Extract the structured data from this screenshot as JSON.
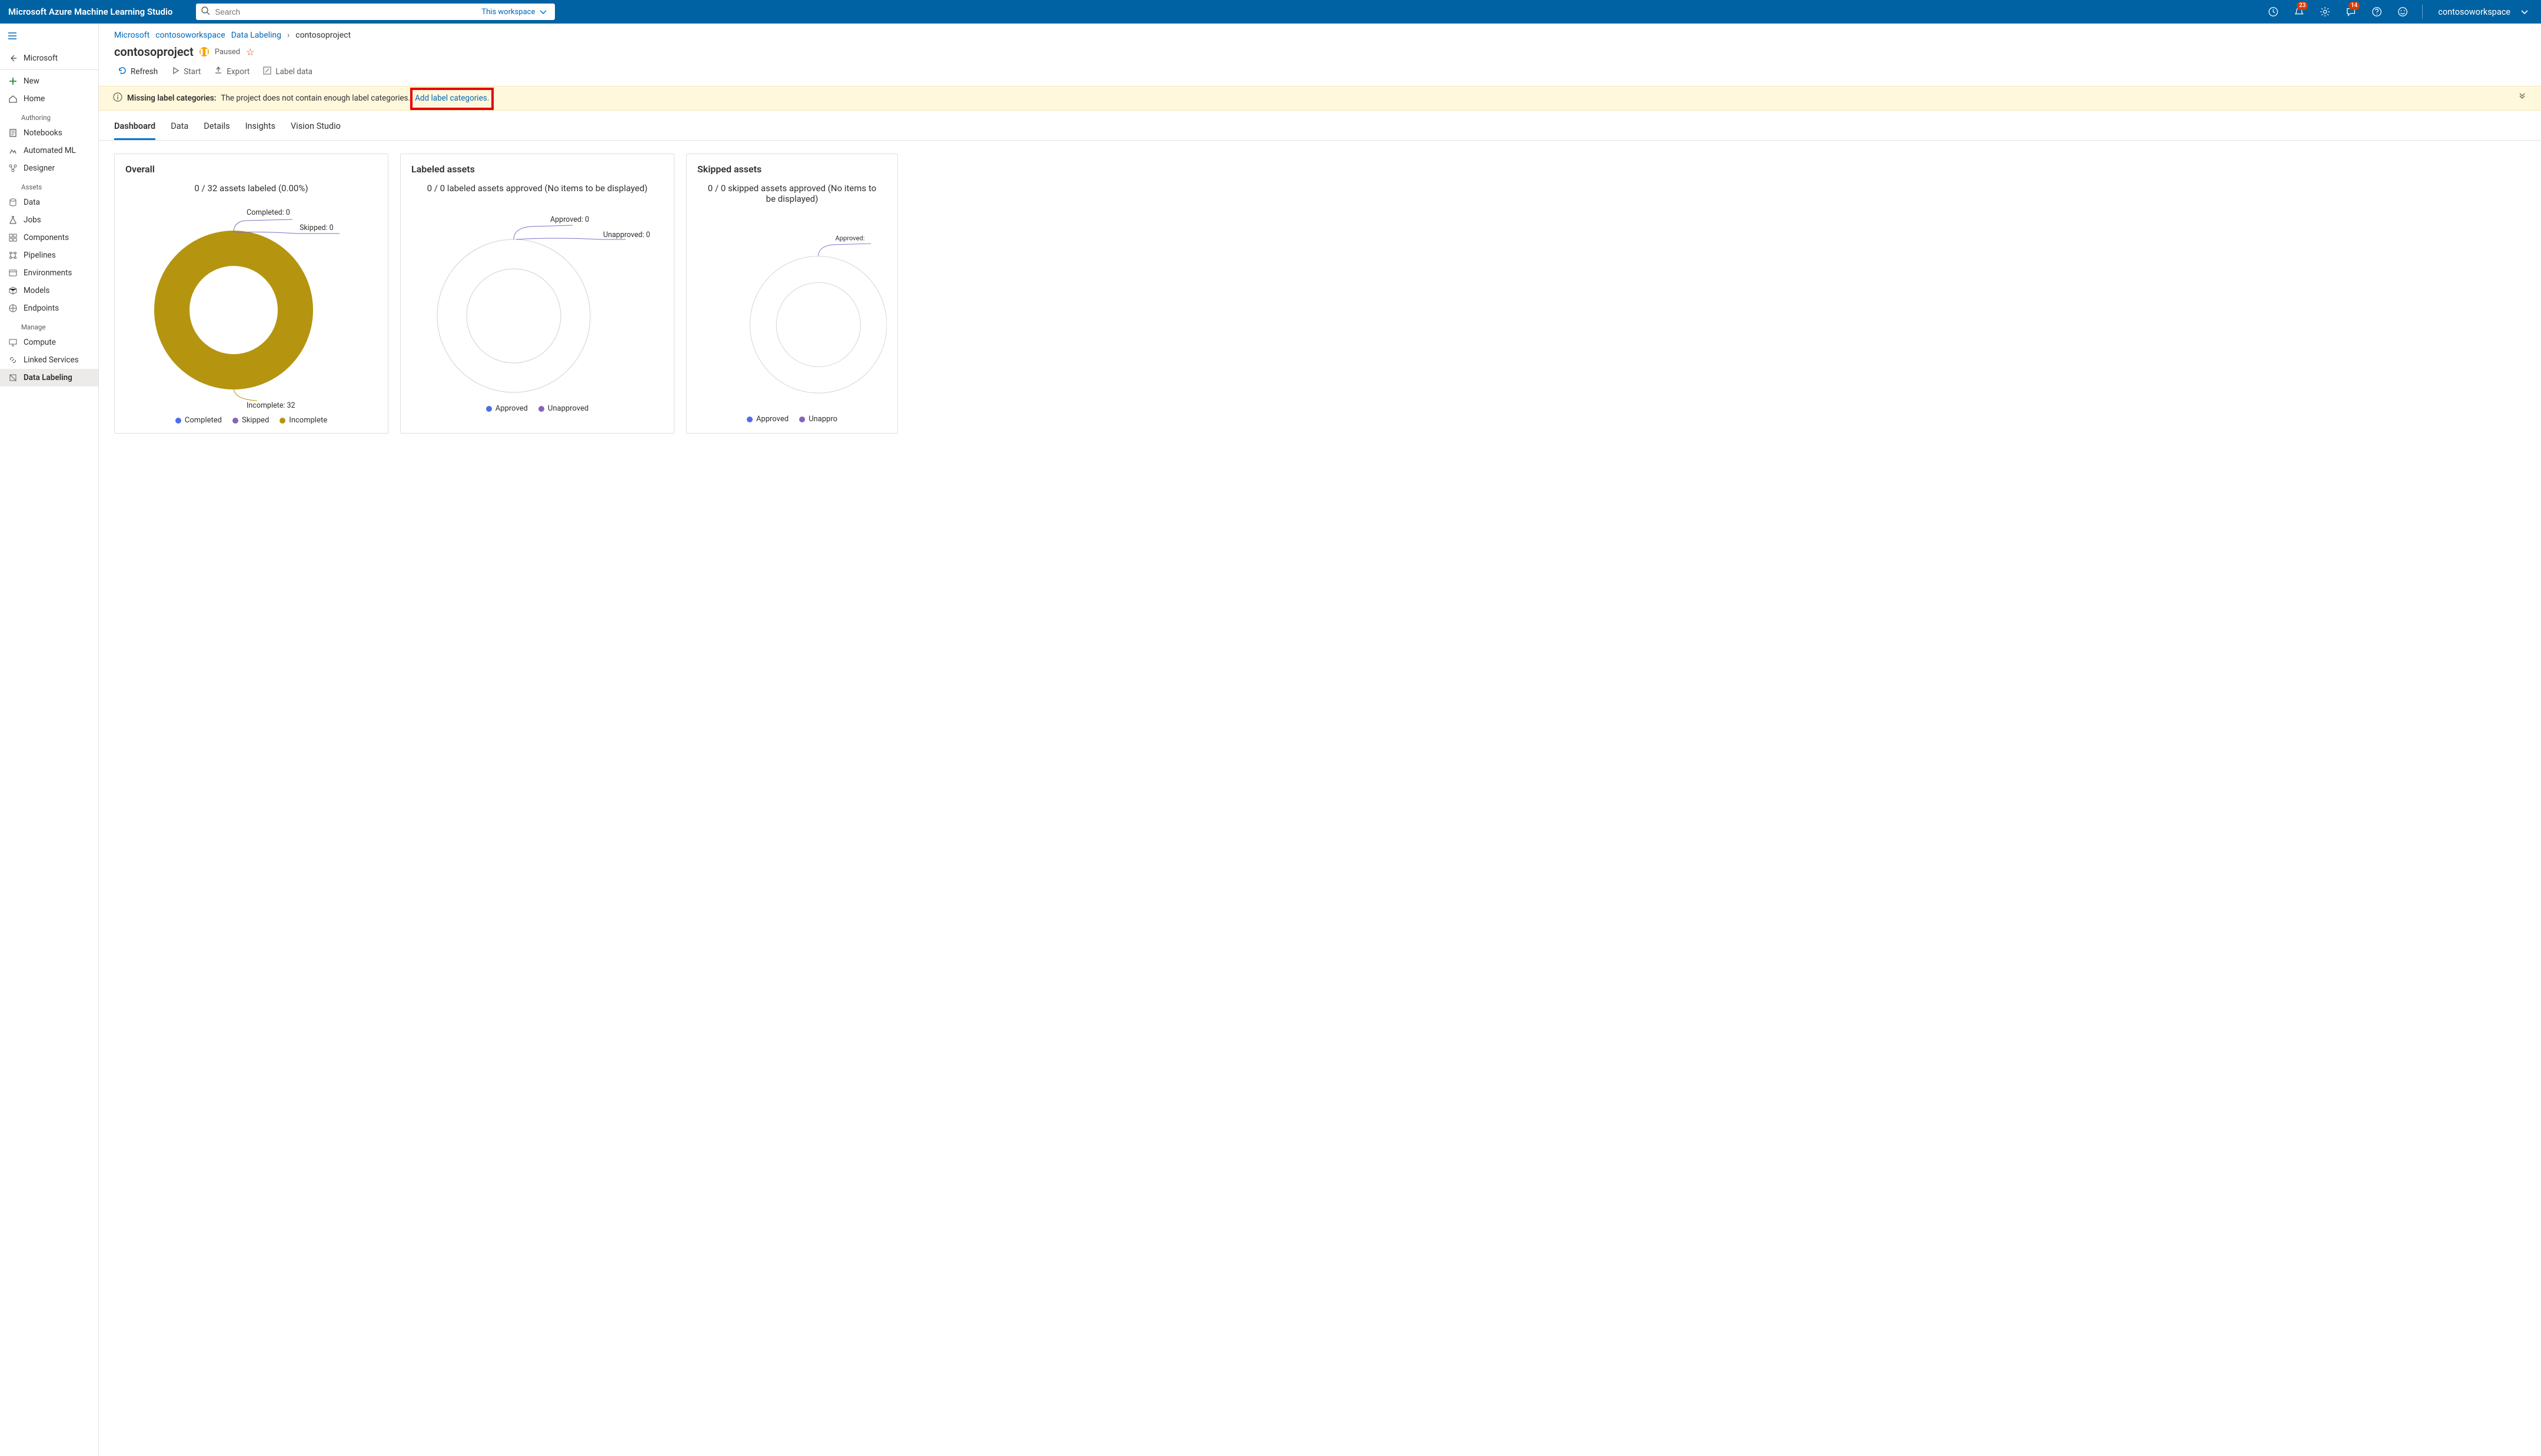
{
  "header": {
    "product": "Microsoft Azure Machine Learning Studio",
    "search_placeholder": "Search",
    "scope": "This workspace",
    "badges": {
      "notifications": "23",
      "feedback": "14"
    },
    "workspace": "contosoworkspace"
  },
  "sidebar": {
    "back_label": "Microsoft",
    "new_label": "New",
    "home_label": "Home",
    "sections": {
      "authoring": "Authoring",
      "assets": "Assets",
      "manage": "Manage"
    },
    "items": {
      "notebooks": "Notebooks",
      "automl": "Automated ML",
      "designer": "Designer",
      "data": "Data",
      "jobs": "Jobs",
      "components": "Components",
      "pipelines": "Pipelines",
      "environments": "Environments",
      "models": "Models",
      "endpoints": "Endpoints",
      "compute": "Compute",
      "linked": "Linked Services",
      "labeling": "Data Labeling"
    }
  },
  "breadcrumbs": {
    "root": "Microsoft",
    "workspace": "contosoworkspace",
    "section": "Data Labeling",
    "current": "contosoproject"
  },
  "page": {
    "title": "contosoproject",
    "status": "Paused"
  },
  "toolbar": {
    "refresh": "Refresh",
    "start": "Start",
    "export": "Export",
    "label_data": "Label data"
  },
  "banner": {
    "prefix": "Missing label categories:",
    "message": "The project does not contain enough label categories.",
    "link": "Add label categories."
  },
  "tabs": {
    "dashboard": "Dashboard",
    "data": "Data",
    "details": "Details",
    "insights": "Insights",
    "vision": "Vision Studio"
  },
  "cards": {
    "overall": {
      "title": "Overall",
      "subtitle": "0 / 32 assets labeled (0.00%)",
      "callouts": {
        "completed": "Completed: 0",
        "skipped": "Skipped: 0",
        "incomplete": "Incomplete: 32"
      },
      "legend": {
        "completed": "Completed",
        "skipped": "Skipped",
        "incomplete": "Incomplete"
      }
    },
    "labeled": {
      "title": "Labeled assets",
      "subtitle": "0 / 0 labeled assets approved (No items to be displayed)",
      "callouts": {
        "approved": "Approved: 0",
        "unapproved": "Unapproved: 0"
      },
      "legend": {
        "approved": "Approved",
        "unapproved": "Unapproved"
      }
    },
    "skipped": {
      "title": "Skipped assets",
      "subtitle": "0 / 0 skipped assets approved (No items to be displayed)",
      "callouts": {
        "approved": "Approved:"
      },
      "legend": {
        "approved": "Approved",
        "unapproved": "Unappro"
      }
    }
  },
  "colors": {
    "completed": "#4f6bed",
    "skipped": "#8764b8",
    "incomplete": "#b59410",
    "approved": "#4f6bed",
    "unapproved": "#8764b8"
  },
  "chart_data": [
    {
      "type": "pie",
      "title": "Overall",
      "subtitle": "0 / 32 assets labeled (0.00%)",
      "series": [
        {
          "name": "Completed",
          "value": 0,
          "color": "#4f6bed"
        },
        {
          "name": "Skipped",
          "value": 0,
          "color": "#8764b8"
        },
        {
          "name": "Incomplete",
          "value": 32,
          "color": "#b59410"
        }
      ]
    },
    {
      "type": "pie",
      "title": "Labeled assets",
      "subtitle": "0 / 0 labeled assets approved (No items to be displayed)",
      "series": [
        {
          "name": "Approved",
          "value": 0,
          "color": "#4f6bed"
        },
        {
          "name": "Unapproved",
          "value": 0,
          "color": "#8764b8"
        }
      ]
    },
    {
      "type": "pie",
      "title": "Skipped assets",
      "subtitle": "0 / 0 skipped assets approved (No items to be displayed)",
      "series": [
        {
          "name": "Approved",
          "value": 0,
          "color": "#4f6bed"
        },
        {
          "name": "Unapproved",
          "value": 0,
          "color": "#8764b8"
        }
      ]
    }
  ]
}
